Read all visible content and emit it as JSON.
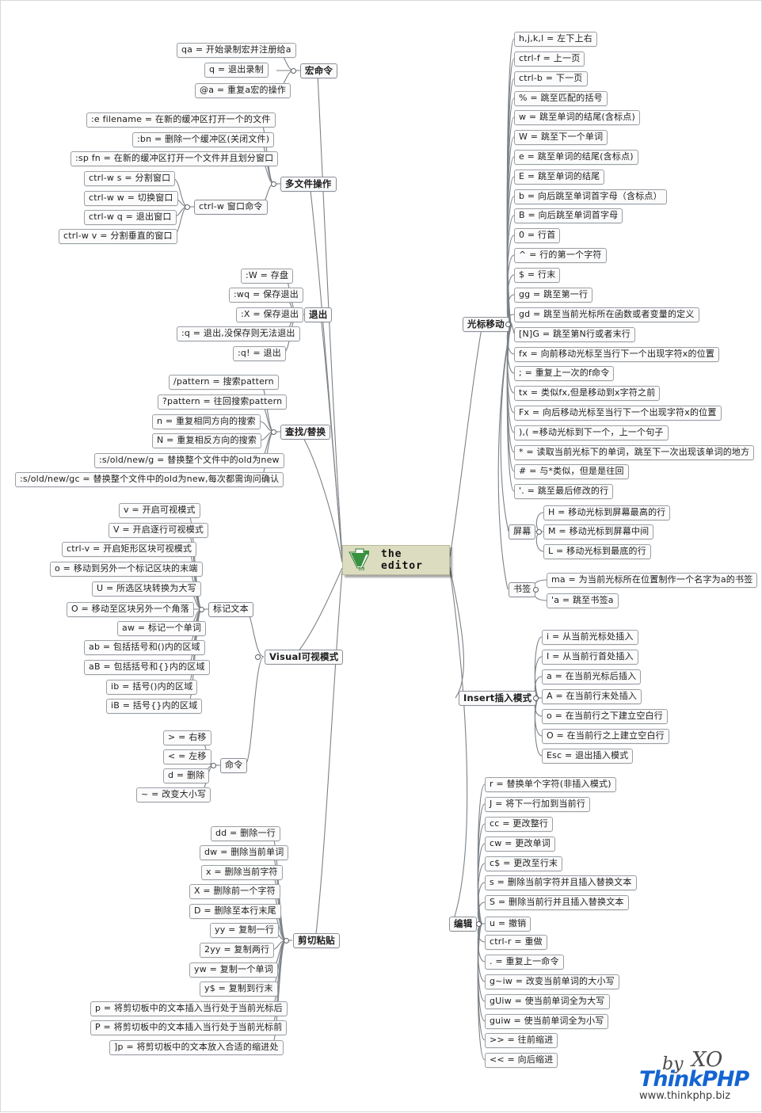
{
  "root": {
    "title": "the editor",
    "logo": "vim-logo"
  },
  "watermark": {
    "brand": "ThinkPHP",
    "url": "www.thinkphp.biz",
    "by": "by",
    "signature": "XO"
  },
  "branches": [
    {
      "id": "macro",
      "label": "宏命令",
      "items": [
        "qa = 开始录制宏并注册给a",
        "q = 退出录制",
        "@a = 重复a宏的操作"
      ]
    },
    {
      "id": "multifile",
      "label": "多文件操作",
      "items": [
        ":e filename = 在新的缓冲区打开一个的文件",
        ":bn = 删除一个缓冲区(关闭文件)",
        ":sp fn = 在新的缓冲区打开一个文件并且划分窗口"
      ],
      "sub": {
        "label": "ctrl-w 窗口命令",
        "items": [
          "ctrl-w s = 分割窗口",
          "ctrl-w w = 切换窗口",
          "ctrl-w q = 退出窗口",
          "ctrl-w v = 分割垂直的窗口"
        ]
      }
    },
    {
      "id": "quit",
      "label": "退出",
      "items": [
        ":W = 存盘",
        ":wq = 保存退出",
        ":X = 保存退出",
        ":q = 退出,没保存则无法退出",
        ":q! = 退出"
      ]
    },
    {
      "id": "findreplace",
      "label": "查找/替换",
      "items": [
        "/pattern = 搜索pattern",
        "?pattern = 往回搜索pattern",
        "n = 重复相同方向的搜索",
        "N = 重复相反方向的搜索",
        ":s/old/new/g = 替换整个文件中的old为new",
        ":s/old/new/gc = 替换整个文件中的old为new,每次都需询问确认"
      ]
    },
    {
      "id": "visual",
      "label": "Visual可视模式",
      "sub": {
        "label": "标记文本",
        "items": [
          "v = 开启可视模式",
          "V = 开启逐行可视模式",
          "ctrl-v = 开启矩形区块可视模式",
          "o = 移动到另外一个标记区块的末端",
          "U = 所选区块转换为大写",
          "O = 移动至区块另外一个角落",
          "aw = 标记一个单词",
          "ab = 包括括号和()内的区域",
          "aB = 包括括号和{}内的区域",
          "ib = 括号()内的区域",
          "iB = 括号{}内的区域"
        ]
      },
      "sub2": {
        "label": "命令",
        "items": [
          "> = 右移",
          "< = 左移",
          "d = 删除",
          "~ = 改变大小写"
        ]
      }
    },
    {
      "id": "cutpaste",
      "label": "剪切粘贴",
      "items": [
        "dd = 删除一行",
        "dw = 删除当前单词",
        "x = 删除当前字符",
        "X = 删除前一个字符",
        "D = 删除至本行末尾",
        "yy = 复制一行",
        "2yy = 复制两行",
        "yw = 复制一个单词",
        "y$ = 复制到行末",
        "p = 将剪切板中的文本插入当行处于当前光标后",
        "P = 将剪切板中的文本插入当行处于当前光标前",
        "]p = 将剪切板中的文本放入合适的缩进处"
      ]
    },
    {
      "id": "cursor",
      "label": "光标移动",
      "items": [
        "h,j,k,l = 左下上右",
        "ctrl-f = 上一页",
        "ctrl-b = 下一页",
        "% = 跳至匹配的括号",
        "w = 跳至单词的结尾(含标点)",
        "W = 跳至下一个单词",
        "e = 跳至单词的结尾(含标点)",
        "E = 跳至单词的结尾",
        "b = 向后跳至单词首字母（含标点）",
        "B = 向后跳至单词首字母",
        "0 = 行首",
        "^ = 行的第一个字符",
        "$ = 行末",
        "gg = 跳至第一行",
        "gd = 跳至当前光标所在函数或者变量的定义",
        "[N]G = 跳至第N行或者末行",
        "fx = 向前移动光标至当行下一个出现字符x的位置",
        "; = 重复上一次的f命令",
        "tx = 类似fx,但是移动到x字符之前",
        "Fx = 向后移动光标至当行下一个出现字符x的位置",
        "),( =移动光标到下一个，上一个句子",
        "* = 读取当前光标下的单词，跳至下一次出现该单词的地方",
        "# = 与*类似，但是是往回",
        "'. = 跳至最后修改的行"
      ],
      "sub": {
        "label": "屏幕",
        "items": [
          "H = 移动光标到屏幕最高的行",
          "M = 移动光标到屏幕中间",
          "L = 移动光标到最底的行"
        ]
      },
      "sub2": {
        "label": "书签",
        "items": [
          "ma = 为当前光标所在位置制作一个名字为a的书签",
          "'a = 跳至书签a"
        ]
      }
    },
    {
      "id": "insert",
      "label": "Insert插入模式",
      "items": [
        "i = 从当前光标处插入",
        "I = 从当前行首处插入",
        "a = 在当前光标后插入",
        "A = 在当前行末处插入",
        "o = 在当前行之下建立空白行",
        "O = 在当前行之上建立空白行",
        "Esc = 退出插入模式"
      ]
    },
    {
      "id": "edit",
      "label": "编辑",
      "items": [
        "r = 替换单个字符(非插入模式)",
        "J = 将下一行加到当前行",
        "cc = 更改整行",
        "cw = 更改单词",
        "c$ = 更改至行末",
        "s = 删除当前字符并且插入替换文本",
        "S = 删除当前行并且插入替换文本",
        "u = 撤销",
        "ctrl-r = 重做",
        ". = 重复上一命令",
        "g~iw = 改变当前单词的大小写",
        "gUiw = 使当前单词全为大写",
        "guiw = 使当前单词全为小写",
        ">> = 往前缩进",
        "<< = 向后缩进"
      ]
    }
  ],
  "colors": {
    "root_bg": "#dcdcc0",
    "node_border": "#9aa0a6",
    "line": "#7d8287",
    "brand": "#1464d2"
  }
}
